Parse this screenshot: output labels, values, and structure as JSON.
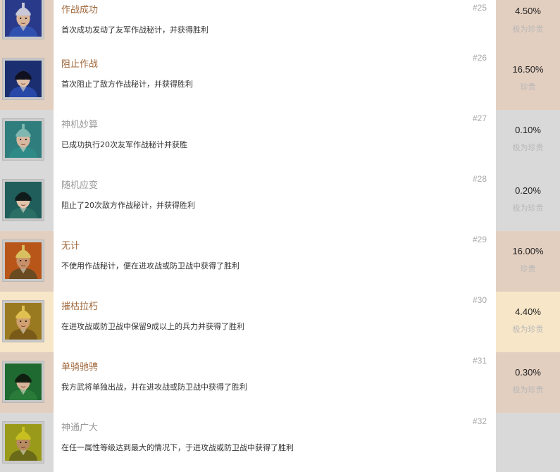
{
  "colors": {
    "locked_bg": "#d9d9d9",
    "unlocked_rare_bg": "#e3cfc0",
    "gold_bg": "#f7e6c8",
    "title_unlocked": "#a0683c",
    "title_locked": "#9a9a9a"
  },
  "achievements": [
    {
      "title": "作战成功",
      "description": "首次成功发动了友军作战秘计，并获得胜利",
      "number": "#25",
      "percent": "4.50%",
      "rarity": "极为珍贵",
      "state": "unlocked",
      "bg": "#e3cfc0",
      "portrait": "blue-armored-general"
    },
    {
      "title": "阻止作战",
      "description": "首次阻止了敌方作战秘计，并获得胜利",
      "number": "#26",
      "percent": "16.50%",
      "rarity": "珍贵",
      "state": "unlocked",
      "bg": "#e3cfc0",
      "portrait": "blue-robed-strategist"
    },
    {
      "title": "神机妙算",
      "description": "已成功执行20次友军作战秘计并获胜",
      "number": "#27",
      "percent": "0.10%",
      "rarity": "极为珍贵",
      "state": "locked",
      "bg": "#d9d9d9",
      "portrait": "teal-helmet-officer"
    },
    {
      "title": "随机应变",
      "description": "阻止了20次敌方作战秘计，并获得胜利",
      "number": "#28",
      "percent": "0.20%",
      "rarity": "极为珍贵",
      "state": "locked",
      "bg": "#d9d9d9",
      "portrait": "teal-robed-warrior"
    },
    {
      "title": "无计",
      "description": "不使用作战秘计，便在进攻战或防卫战中获得了胜利",
      "number": "#29",
      "percent": "16.00%",
      "rarity": "珍贵",
      "state": "unlocked",
      "bg": "#e3cfc0",
      "portrait": "fiery-bearded-warlord"
    },
    {
      "title": "摧枯拉朽",
      "description": "在进攻战或防卫战中保留9成以上的兵力并获得了胜利",
      "number": "#30",
      "percent": "4.40%",
      "rarity": "极为珍贵",
      "state": "unlocked",
      "bg": "#f7e6c8",
      "portrait": "golden-helmet-general"
    },
    {
      "title": "单骑驰骋",
      "description": "我方武将单独出战，并在进攻战或防卫战中获得了胜利",
      "number": "#31",
      "percent": "0.30%",
      "rarity": "极为珍贵",
      "state": "unlocked",
      "bg": "#e3cfc0",
      "portrait": "green-armored-swordsman"
    },
    {
      "title": "神通广大",
      "description": "在任一属性等级达到最大的情况下，于进攻战或防卫战中获得了胜利",
      "number": "#32",
      "percent": "",
      "rarity": "",
      "state": "locked",
      "bg": "#d9d9d9",
      "portrait": "yellow-hat-bearded-elder"
    }
  ]
}
